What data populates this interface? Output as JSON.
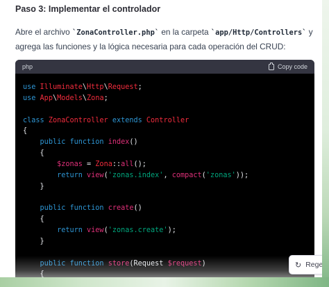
{
  "heading": "Paso 3: Implementar el controlador",
  "paragraph": {
    "part1": "Abre el archivo ",
    "code1": "`ZonaController.php`",
    "part2": " en la carpeta ",
    "code2": "`app/Http/Controllers`",
    "part3": " y agrega las funciones y la lógica necesaria para cada operación del CRUD:"
  },
  "code_block": {
    "language": "php",
    "copy_label": "Copy code",
    "copy_icon": "clipboard-icon",
    "lines": [
      [
        [
          "kw",
          "use "
        ],
        [
          "cls",
          "Illuminate"
        ],
        [
          "",
          "\\"
        ],
        [
          "cls",
          "Http"
        ],
        [
          "",
          "\\"
        ],
        [
          "cls",
          "Request"
        ],
        [
          "",
          ";"
        ]
      ],
      [
        [
          "kw",
          "use "
        ],
        [
          "cls",
          "App"
        ],
        [
          "",
          "\\"
        ],
        [
          "cls",
          "Models"
        ],
        [
          "",
          "\\"
        ],
        [
          "cls",
          "Zona"
        ],
        [
          "",
          ";"
        ]
      ],
      [],
      [
        [
          "kw",
          "class "
        ],
        [
          "cls",
          "ZonaController "
        ],
        [
          "kw",
          "extends "
        ],
        [
          "cls",
          "Controller"
        ]
      ],
      [
        [
          "",
          "{"
        ]
      ],
      [
        [
          "",
          "    "
        ],
        [
          "kw",
          "public function "
        ],
        [
          "fn",
          "index"
        ],
        [
          "",
          "()"
        ]
      ],
      [
        [
          "",
          "    {"
        ]
      ],
      [
        [
          "",
          "        "
        ],
        [
          "var",
          "$zonas"
        ],
        [
          "",
          " = "
        ],
        [
          "cls",
          "Zona"
        ],
        [
          "",
          "::"
        ],
        [
          "fn",
          "all"
        ],
        [
          "",
          "();"
        ]
      ],
      [
        [
          "",
          "        "
        ],
        [
          "kw",
          "return "
        ],
        [
          "fn",
          "view"
        ],
        [
          "",
          "("
        ],
        [
          "str",
          "'zonas.index'"
        ],
        [
          "",
          ", "
        ],
        [
          "fn",
          "compact"
        ],
        [
          "",
          "("
        ],
        [
          "str",
          "'zonas'"
        ],
        [
          "",
          "));"
        ]
      ],
      [
        [
          "",
          "    }"
        ]
      ],
      [],
      [
        [
          "",
          "    "
        ],
        [
          "kw",
          "public function "
        ],
        [
          "fn",
          "create"
        ],
        [
          "",
          "()"
        ]
      ],
      [
        [
          "",
          "    {"
        ]
      ],
      [
        [
          "",
          "        "
        ],
        [
          "kw",
          "return "
        ],
        [
          "fn",
          "view"
        ],
        [
          "",
          "("
        ],
        [
          "str",
          "'zonas.create'"
        ],
        [
          "",
          ");"
        ]
      ],
      [
        [
          "",
          "    }"
        ]
      ],
      [],
      [
        [
          "",
          "    "
        ],
        [
          "kw",
          "public function "
        ],
        [
          "fn",
          "store"
        ],
        [
          "",
          "(Request "
        ],
        [
          "var",
          "$request"
        ],
        [
          "",
          ")"
        ]
      ],
      [
        [
          "",
          "    {"
        ]
      ]
    ]
  },
  "regenerate": {
    "label": "Regene",
    "icon": "refresh-icon"
  }
}
